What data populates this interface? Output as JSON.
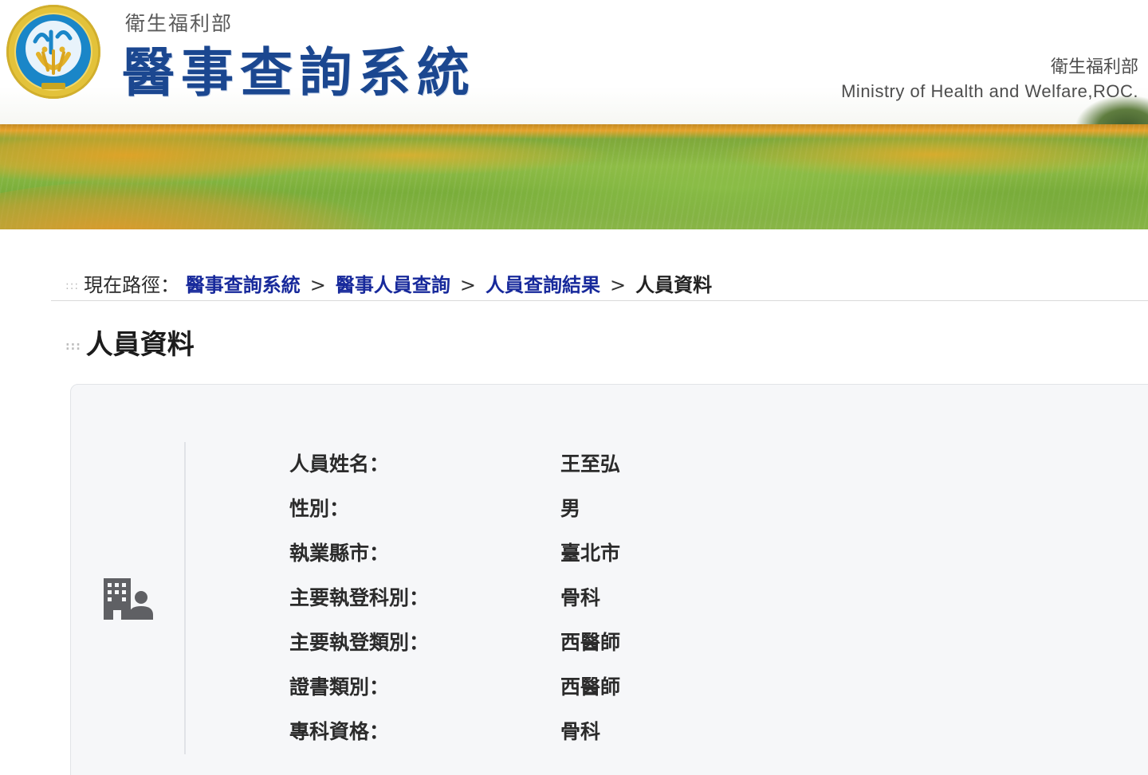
{
  "header": {
    "ministry_cn_small": "衛生福利部",
    "system_title": "醫事查詢系統",
    "ministry_cn_right": "衛生福利部",
    "ministry_en": "Ministry of Health and Welfare,ROC."
  },
  "breadcrumb": {
    "label": "現在路徑：",
    "items": [
      {
        "label": "醫事查詢系統",
        "link": true
      },
      {
        "label": "醫事人員查詢",
        "link": true
      },
      {
        "label": "人員查詢結果",
        "link": true
      },
      {
        "label": "人員資料",
        "link": false
      }
    ],
    "separator": ">",
    "dots": ":::"
  },
  "section": {
    "title": "人員資料",
    "dots": ":::"
  },
  "person": {
    "icon": "building-person-icon",
    "fields": [
      {
        "label": "人員姓名：",
        "value": "王至弘"
      },
      {
        "label": "性別：",
        "value": "男"
      },
      {
        "label": "執業縣市：",
        "value": "臺北市"
      },
      {
        "label": "主要執登科別：",
        "value": "骨科"
      },
      {
        "label": "主要執登類別：",
        "value": "西醫師"
      },
      {
        "label": "證書類別：",
        "value": "西醫師"
      },
      {
        "label": "專科資格：",
        "value": "骨科"
      }
    ]
  },
  "colors": {
    "title_blue": "#1b4790",
    "link_blue": "#17299b",
    "card_bg": "#f6f7f9",
    "icon_gray": "#5f6064"
  }
}
